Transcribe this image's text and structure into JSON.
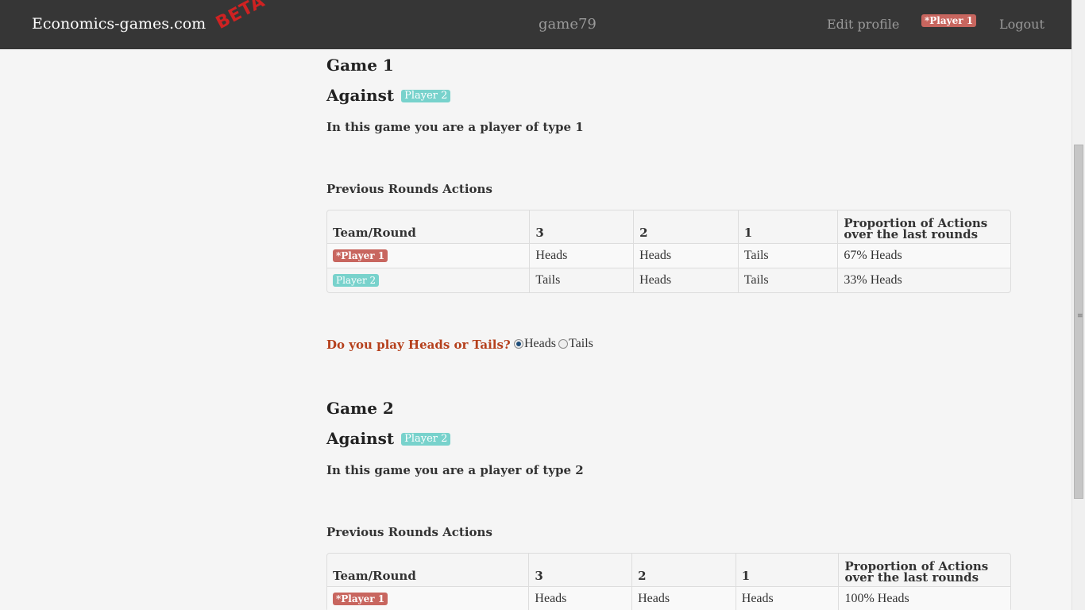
{
  "navbar": {
    "brand": "Economics-games.com",
    "beta": "BETA",
    "center": "game79",
    "edit_profile": "Edit profile",
    "player_badge": "*Player 1",
    "logout": "Logout"
  },
  "games": [
    {
      "title": "Game 1",
      "against_label": "Against",
      "opponent": "Player 2",
      "type_text": "In this game you are a player of type 1",
      "prev_title": "Previous Rounds Actions",
      "headers": [
        "Team/Round",
        "3",
        "2",
        "1",
        "Proportion of Actions over the last rounds"
      ],
      "rows": [
        {
          "team": "*Player 1",
          "r3": "Heads",
          "r2": "Heads",
          "r1": "Tails",
          "prop": "67% Heads"
        },
        {
          "team": "Player 2",
          "r3": "Tails",
          "r2": "Heads",
          "r1": "Tails",
          "prop": "33% Heads"
        }
      ],
      "question": "Do you play Heads or Tails?",
      "options": [
        "Heads",
        "Tails"
      ],
      "selected": "Heads"
    },
    {
      "title": "Game 2",
      "against_label": "Against",
      "opponent": "Player 2",
      "type_text": "In this game you are a player of type 2",
      "prev_title": "Previous Rounds Actions",
      "headers": [
        "Team/Round",
        "3",
        "2",
        "1",
        "Proportion of Actions over the last rounds"
      ],
      "rows": [
        {
          "team": "*Player 1",
          "r3": "Heads",
          "r2": "Heads",
          "r1": "Heads",
          "prop": "100% Heads"
        }
      ]
    }
  ],
  "colors": {
    "navbar_bg": "#363636",
    "player1_badge": "#c8665f",
    "player2_badge": "#78d2cc",
    "question_text": "#b5401c"
  }
}
